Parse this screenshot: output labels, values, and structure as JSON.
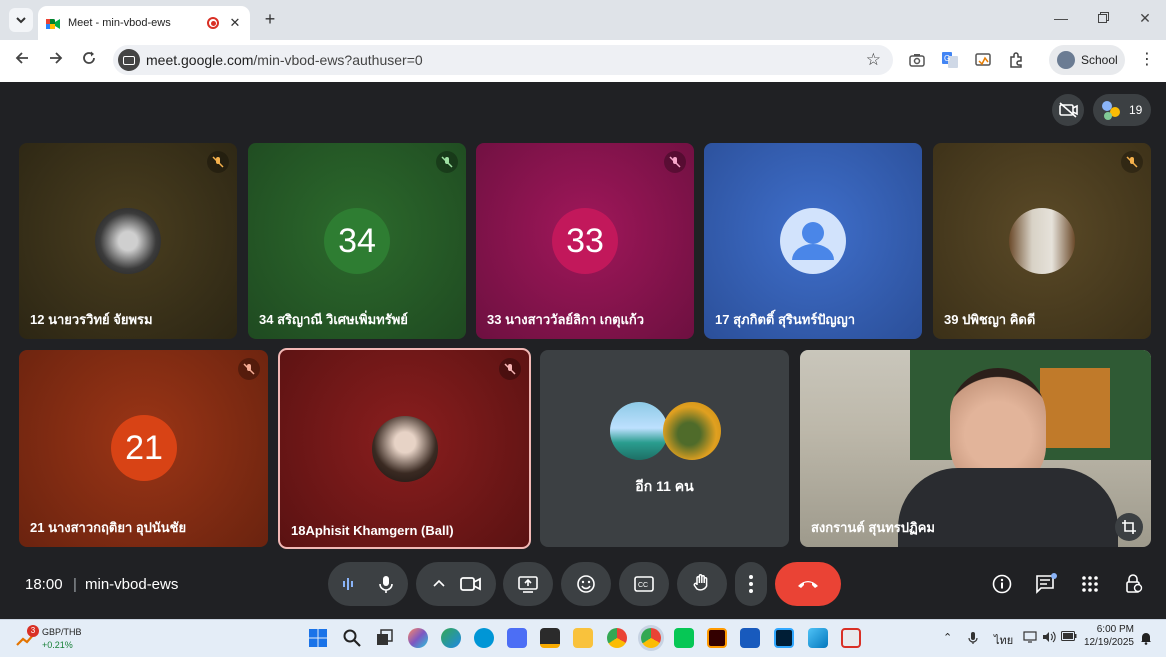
{
  "browser": {
    "tab_title": "Meet - min-vbod-ews",
    "url_host": "meet.google.com",
    "url_path": "/min-vbod-ews?authuser=0",
    "profile_label": "School"
  },
  "meet": {
    "participant_count": "19",
    "tiles": [
      {
        "name": "12 นายวรวิทย์ จัยพรม",
        "kind": "photo",
        "muted": true
      },
      {
        "name": "34 สริญาณี วิเศษเพิ่มทรัพย์",
        "kind": "number",
        "number": "34",
        "muted": true
      },
      {
        "name": "33 นางสาววัลย์ลิกา เกตุแก้ว",
        "kind": "number",
        "number": "33",
        "muted": true
      },
      {
        "name": "17 สุภกิตติ์ สุรินทร์ปัญญา",
        "kind": "avatar",
        "muted": false
      },
      {
        "name": "39 ปพิชญา คิดดี",
        "kind": "photo",
        "muted": true
      },
      {
        "name": "21 นางสาวกฤติยา อุปนันชัย",
        "kind": "number",
        "number": "21",
        "muted": true
      },
      {
        "name": "18Aphisit Khamgern (Ball)",
        "kind": "photo",
        "muted": true
      },
      {
        "name": "อีก 11 คน",
        "kind": "others",
        "muted": false
      },
      {
        "name": "สงกรานต์ สุนทรปฏิคม",
        "kind": "video",
        "muted": false
      }
    ],
    "time": "18:00",
    "meeting_code": "min-vbod-ews",
    "colors": {
      "background": "#202124",
      "control": "#3c4043",
      "end_call": "#ea4335",
      "active_outline": "#f2b8b5"
    }
  },
  "taskbar": {
    "widget_badge": "3",
    "widget_title": "GBP/THB",
    "widget_value": "+0.21%",
    "lang": "ไทย",
    "clock_time": "6:00 PM",
    "clock_date": "12/19/2025"
  }
}
